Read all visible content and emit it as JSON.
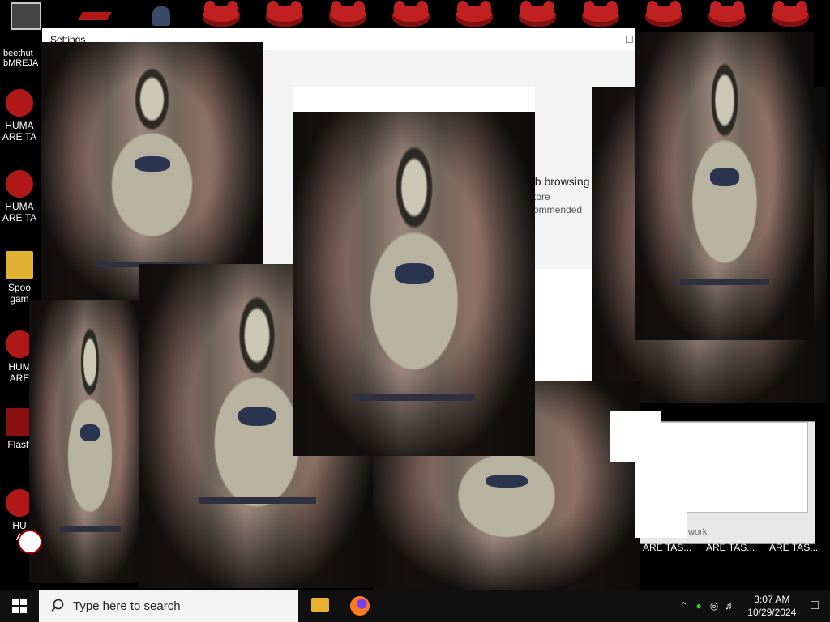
{
  "desktop": {
    "top_icons": [
      "human-head",
      "human-head",
      "human-head",
      "human-head",
      "human-head",
      "human-head",
      "human-head",
      "human-head",
      "human-head",
      "human-head"
    ],
    "left_icons": [
      {
        "label": "HUMA\nARE TA",
        "icon": "red-head-icon"
      },
      {
        "label": "HUMA\nARE TA",
        "icon": "red-head-icon"
      },
      {
        "label": "Spoo\ngam",
        "icon": "folder-icon"
      },
      {
        "label": "HUM\nARE",
        "icon": "red-head-icon"
      },
      {
        "label": "Flash",
        "icon": "flash-icon"
      },
      {
        "label": "HU\nA",
        "icon": "red-head-icon"
      }
    ],
    "bottom_labels": [
      "ARE TAS...",
      "ARE TAS...",
      "ARE TAS..."
    ],
    "top_left_label": "beethut\nbMREJA"
  },
  "settings": {
    "title": "Settings",
    "line1": "eb browsing",
    "line2": "store",
    "line3": "commended"
  },
  "misc": {
    "network_label": "work",
    "link_fragment": "2"
  },
  "taskbar": {
    "search_placeholder": "Type here to search",
    "time": "3:07 AM",
    "date": "10/29/2024"
  }
}
